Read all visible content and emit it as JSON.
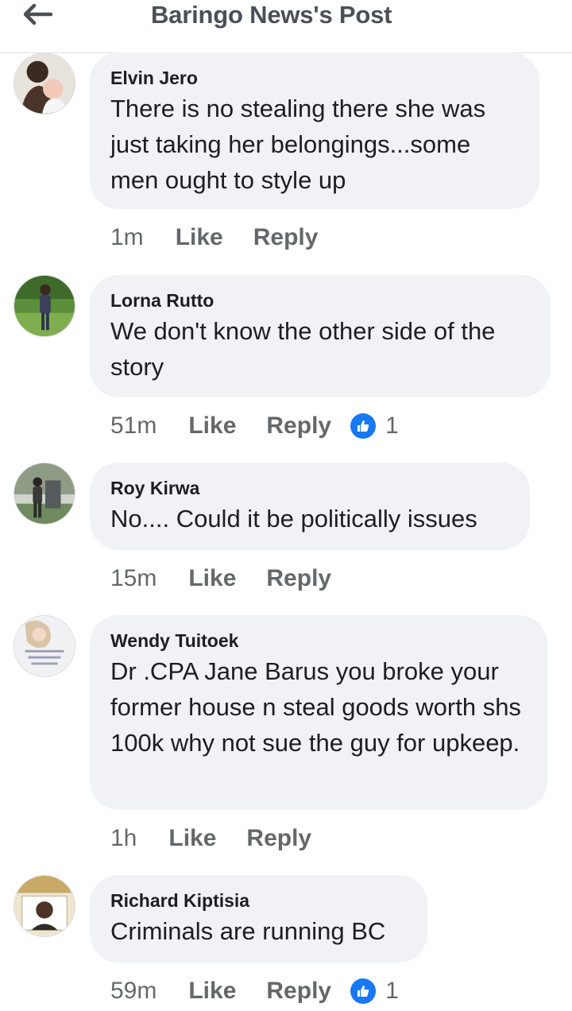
{
  "header": {
    "title": "Baringo News's Post",
    "back_icon": "arrow-left-icon"
  },
  "actions": {
    "like_label": "Like",
    "reply_label": "Reply"
  },
  "colors": {
    "bubble": "#f0f2f5",
    "reaction_blue": "#1877f2",
    "meta_gray": "#65676b"
  },
  "comments": [
    {
      "author": "Elvin Jero",
      "text": "There is no stealing there she was just taking her belongings...some men ought to style up",
      "time": "1m",
      "reactions": null
    },
    {
      "author": "Lorna Rutto",
      "text": "We don't know the other side of the story",
      "time": "51m",
      "reactions": "1"
    },
    {
      "author": "Roy Kirwa",
      "text": "No.... Could it be politically issues",
      "time": "15m",
      "reactions": null
    },
    {
      "author": "Wendy Tuitoek",
      "text": "Dr .CPA Jane Barus you broke your former house n steal goods worth shs 100k why not sue the guy for upkeep.",
      "time": "1h",
      "reactions": null
    },
    {
      "author": "Richard Kiptisia",
      "text": "Criminals are running BC",
      "time": "59m",
      "reactions": "1"
    }
  ]
}
